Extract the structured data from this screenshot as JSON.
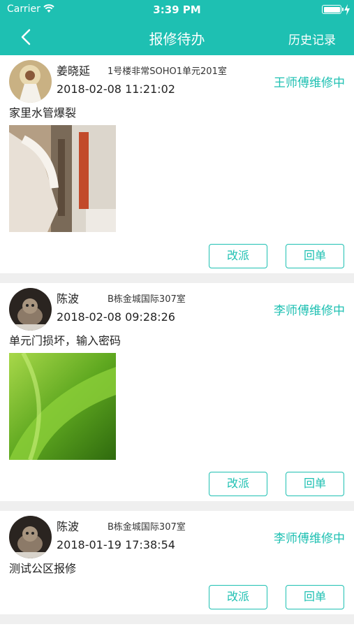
{
  "status_bar": {
    "carrier": "Carrier",
    "time": "3:39 PM"
  },
  "nav": {
    "title": "报修待办",
    "history_label": "历史记录"
  },
  "colors": {
    "accent": "#1ec0b2",
    "background": "#efefef"
  },
  "items": [
    {
      "name": "姜晓延",
      "address": "1号楼非常SOHO1单元201室",
      "datetime": "2018-02-08 11:21:02",
      "status": "王师傅维修中",
      "description": "家里水管爆裂",
      "reassign_label": "改派",
      "reply_label": "回单"
    },
    {
      "name": "陈波",
      "address": "B栋金城国际307室",
      "datetime": "2018-02-08 09:28:26",
      "status": "李师傅维修中",
      "description": "单元门损坏，输入密码",
      "reassign_label": "改派",
      "reply_label": "回单"
    },
    {
      "name": "陈波",
      "address": "B栋金城国际307室",
      "datetime": "2018-01-19 17:38:54",
      "status": "李师傅维修中",
      "description": "测试公区报修",
      "reassign_label": "改派",
      "reply_label": "回单"
    }
  ]
}
